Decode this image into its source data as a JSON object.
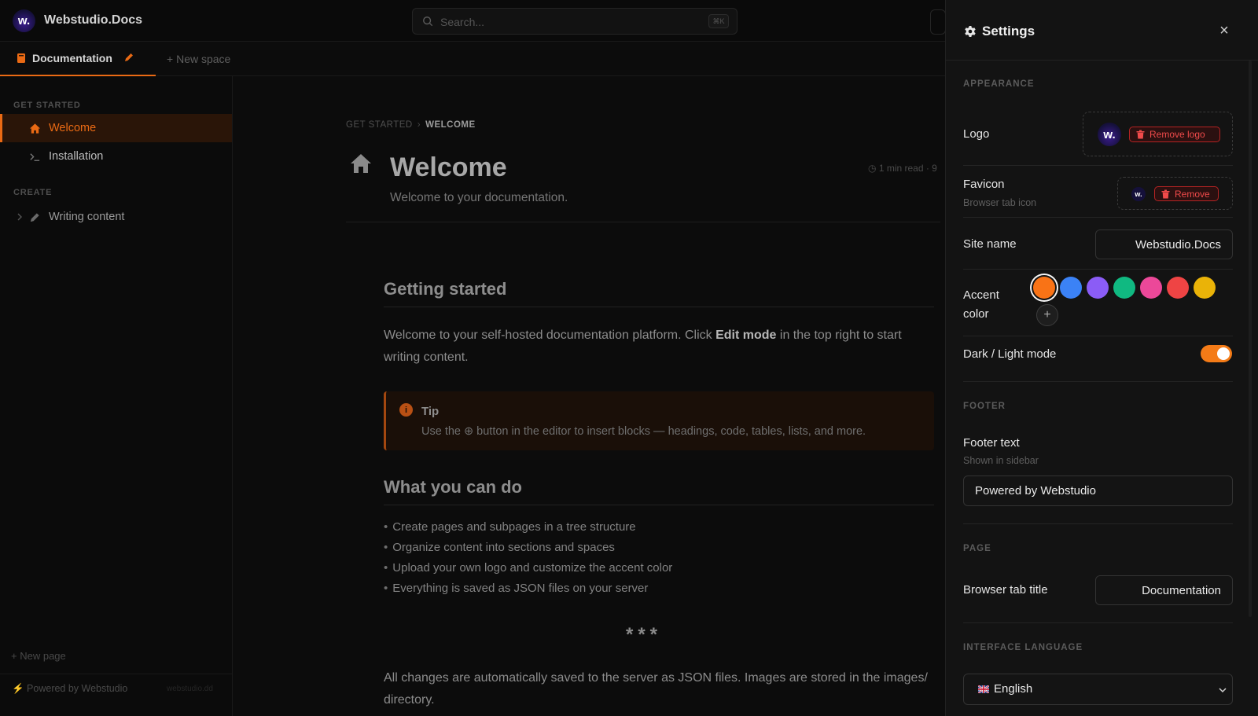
{
  "topbar": {
    "logo_text": "w.",
    "site_title": "Webstudio.Docs",
    "search_placeholder": "Search...",
    "search_shortcut": "⌘K"
  },
  "tabs": {
    "active_label": "Documentation",
    "new_space_label": "New space"
  },
  "sidebar": {
    "sections": [
      {
        "title": "GET STARTED",
        "items": [
          {
            "label": "Welcome",
            "icon": "home-icon",
            "active": true
          },
          {
            "label": "Installation",
            "icon": "terminal-icon",
            "active": false
          }
        ]
      },
      {
        "title": "CREATE",
        "items": [
          {
            "label": "Writing content",
            "icon": "pencil-icon",
            "active": false,
            "collapsible": true
          }
        ]
      }
    ],
    "new_page_label": "New page",
    "powered_label": "Powered by Webstudio",
    "footer_small": "webstudio.dd"
  },
  "main": {
    "breadcrumb": {
      "parent": "GET STARTED",
      "current": "WELCOME"
    },
    "title": "Welcome",
    "subtitle": "Welcome to your documentation.",
    "read_time": "1 min read · 9",
    "h2_getting_started": "Getting started",
    "para1_before": "Welcome to your self-hosted documentation platform. Click ",
    "para1_bold": "Edit mode",
    "para1_after": " in the top right to start writing content.",
    "tip": {
      "title": "Tip",
      "text": "Use the ⊕ button in the editor to insert blocks — headings, code, tables, lists, and more."
    },
    "h2_what_you_can_do": "What you can do",
    "bullets": [
      "Create pages and subpages in a tree structure",
      "Organize content into sections and spaces",
      "Upload your own logo and customize the accent color",
      "Everything is saved as JSON files on your server"
    ],
    "divider": "***",
    "para2": "All changes are automatically saved to the server as JSON files. Images are stored in the images/ directory."
  },
  "settings": {
    "title": "Settings",
    "close_glyph": "×",
    "appearance": {
      "section_title": "APPEARANCE",
      "logo_label": "Logo",
      "logo_thumb_text": "w.",
      "remove_logo_label": "Remove logo",
      "favicon_label": "Favicon",
      "favicon_sub": "Browser tab icon",
      "favicon_thumb_text": "w.",
      "remove_favicon_label": "Remove",
      "site_name_label": "Site name",
      "site_name_value": "Webstudio.Docs",
      "accent_label": "Accent color",
      "accent_colors": [
        "#f97316",
        "#3b82f6",
        "#8b5cf6",
        "#10b981",
        "#ec4899",
        "#ef4444",
        "#eab308"
      ],
      "accent_selected": "#f97316",
      "add_color_glyph": "+",
      "mode_label": "Dark / Light mode",
      "mode_toggle_on": true
    },
    "footer": {
      "section_title": "FOOTER",
      "footer_text_label": "Footer text",
      "footer_text_sub": "Shown in sidebar",
      "footer_text_value": "Powered by Webstudio"
    },
    "page": {
      "section_title": "PAGE",
      "tab_title_label": "Browser tab title",
      "tab_title_value": "Documentation"
    },
    "language": {
      "section_title": "INTERFACE LANGUAGE",
      "selected": "English",
      "flag": "uk-flag-icon"
    }
  },
  "colors": {
    "accent": "#ea6a14",
    "danger": "#ef4a4a",
    "panel_bg": "#131313"
  }
}
